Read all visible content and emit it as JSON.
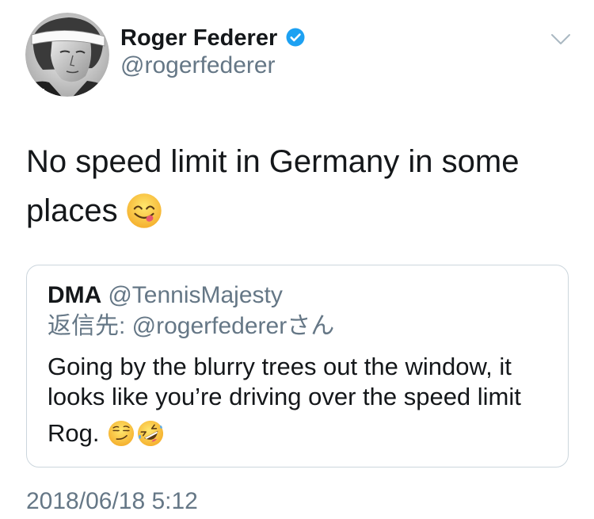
{
  "author": {
    "name": "Roger Federer",
    "handle": "@rogerfederer"
  },
  "tweet": {
    "lines": [
      "No speed limit in Germany in some",
      "places"
    ],
    "emoji": "face-savoring-food-emoji"
  },
  "quote": {
    "name": "DMA",
    "handle": "@TennisMajesty",
    "reply_to": "返信先: @rogerfedererさん",
    "lines": [
      "Going by the blurry trees out the window, it",
      "looks like you’re driving over the speed limit",
      "Rog."
    ],
    "emojis": [
      "smirking-face-emoji",
      "rolling-on-the-floor-laughing-emoji"
    ]
  },
  "timestamp": "2018/06/18 5:12",
  "icons": {
    "verified": "verified-badge-icon",
    "menu": "chevron-down-icon",
    "avatar": "avatar"
  },
  "colors": {
    "primary_text": "#14171a",
    "secondary_text": "#657786",
    "verified": "#1da1f2",
    "card_border": "#ccd6dd",
    "background": "#ffffff"
  }
}
